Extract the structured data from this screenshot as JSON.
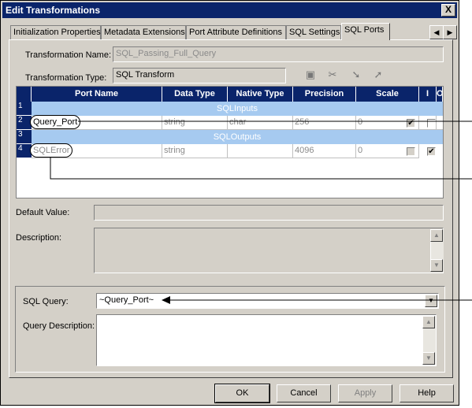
{
  "window": {
    "title": "Edit Transformations",
    "close_glyph": "X"
  },
  "tabs": [
    {
      "label": "Initialization Properties",
      "active": false
    },
    {
      "label": "Metadata Extensions",
      "active": false
    },
    {
      "label": "Port Attribute Definitions",
      "active": false
    },
    {
      "label": "SQL Settings",
      "active": false
    },
    {
      "label": "SQL Ports",
      "active": true
    }
  ],
  "form": {
    "transformation_name_label": "Transformation Name:",
    "transformation_name_value": "SQL_Passing_Full_Query",
    "transformation_type_label": "Transformation Type:",
    "transformation_type_value": "SQL Transform"
  },
  "grid": {
    "columns": [
      "Port Name",
      "Data Type",
      "Native Type",
      "Precision",
      "Scale",
      "I",
      "O"
    ],
    "row_numbers": [
      "1",
      "2",
      "3",
      "4"
    ],
    "groups": {
      "inputs": "SQLInputs",
      "outputs": "SQLOutputs"
    },
    "rows": [
      {
        "port_name": "Query_Port",
        "data_type": "string",
        "native_type": "char",
        "precision": "256",
        "scale": "0",
        "input": true,
        "output": false
      },
      {
        "port_name": "SQLError",
        "data_type": "string",
        "native_type": "",
        "precision": "4096",
        "scale": "0",
        "input": false,
        "output": true
      }
    ]
  },
  "default_value_label": "Default Value:",
  "description_label": "Description:",
  "sql_query_label": "SQL Query:",
  "sql_query_value": "~Query_Port~",
  "query_description_label": "Query Description:",
  "buttons": {
    "ok": "OK",
    "cancel": "Cancel",
    "apply": "Apply",
    "help": "Help"
  },
  "icons": [
    "new-port-icon",
    "cut-icon",
    "move-down-icon",
    "move-up-icon"
  ]
}
